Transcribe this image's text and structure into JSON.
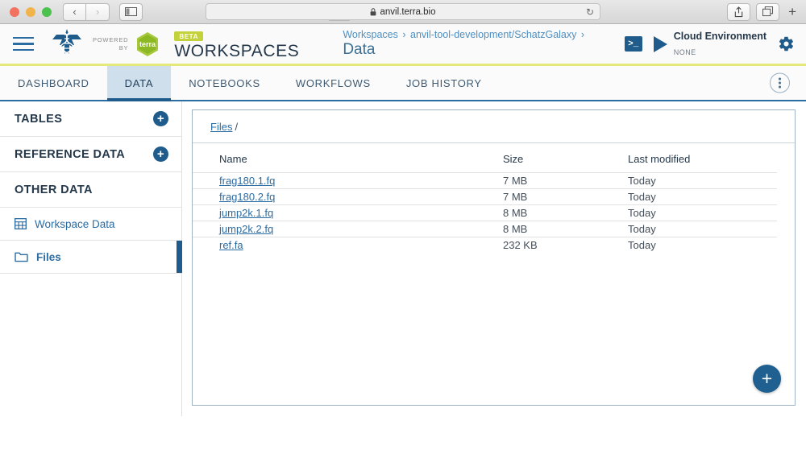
{
  "browser": {
    "url": "anvil.terra.bio",
    "lock_icon": "lock-icon",
    "back_icon": "‹",
    "forward_icon": "›",
    "sidebar_icon": "sidebar-toggle-icon",
    "theme_icon": "appearance-icon",
    "reload_icon": "↻",
    "share_icon": "share-icon",
    "tabs_icon": "show-tabs-icon",
    "new_tab_icon": "+"
  },
  "header": {
    "menu_icon": "hamburger-menu-icon",
    "logo_name": "anvil-logo",
    "powered_by_line1": "POWERED",
    "powered_by_line2": "BY",
    "terra_logo_text": "terra",
    "beta_badge": "BETA",
    "app_title": "WORKSPACES",
    "breadcrumb": {
      "root": "Workspaces",
      "separator": "›",
      "workspace": "anvil-tool-development/SchatzGalaxy",
      "current": "Data"
    },
    "terminal_icon": ">_",
    "cloud_env_title": "Cloud Environment",
    "cloud_env_status": "NONE",
    "gear_icon": "gear-icon"
  },
  "tabs": [
    {
      "label": "DASHBOARD",
      "active": false
    },
    {
      "label": "DATA",
      "active": true
    },
    {
      "label": "NOTEBOOKS",
      "active": false
    },
    {
      "label": "WORKFLOWS",
      "active": false
    },
    {
      "label": "JOB HISTORY",
      "active": false
    }
  ],
  "tabbar": {
    "kebab_icon": "more-options-icon"
  },
  "sidebar": {
    "sections": [
      {
        "label": "TABLES",
        "has_add": true,
        "add_icon": "+"
      },
      {
        "label": "REFERENCE DATA",
        "has_add": true,
        "add_icon": "+"
      },
      {
        "label": "OTHER DATA",
        "has_add": false
      }
    ],
    "items": [
      {
        "label": "Workspace Data",
        "icon": "table-icon",
        "active": false
      },
      {
        "label": "Files",
        "icon": "folder-icon",
        "active": true
      }
    ]
  },
  "panel": {
    "breadcrumb_link": "Files",
    "breadcrumb_slash": "/",
    "columns": [
      "Name",
      "Size",
      "Last modified"
    ],
    "rows": [
      {
        "name": "frag180.1.fq",
        "size": "7 MB",
        "modified": "Today"
      },
      {
        "name": "frag180.2.fq",
        "size": "7 MB",
        "modified": "Today"
      },
      {
        "name": "jump2k.1.fq",
        "size": "8 MB",
        "modified": "Today"
      },
      {
        "name": "jump2k.2.fq",
        "size": "8 MB",
        "modified": "Today"
      },
      {
        "name": "ref.fa",
        "size": "232 KB",
        "modified": "Today"
      }
    ],
    "fab_icon": "+"
  },
  "colors": {
    "accent_blue": "#1f5c8b",
    "link_blue": "#2b6ca3",
    "beta_green": "#c3d13b",
    "header_underline": "#e5e87a",
    "active_tab_bg": "#cfe0ec"
  }
}
